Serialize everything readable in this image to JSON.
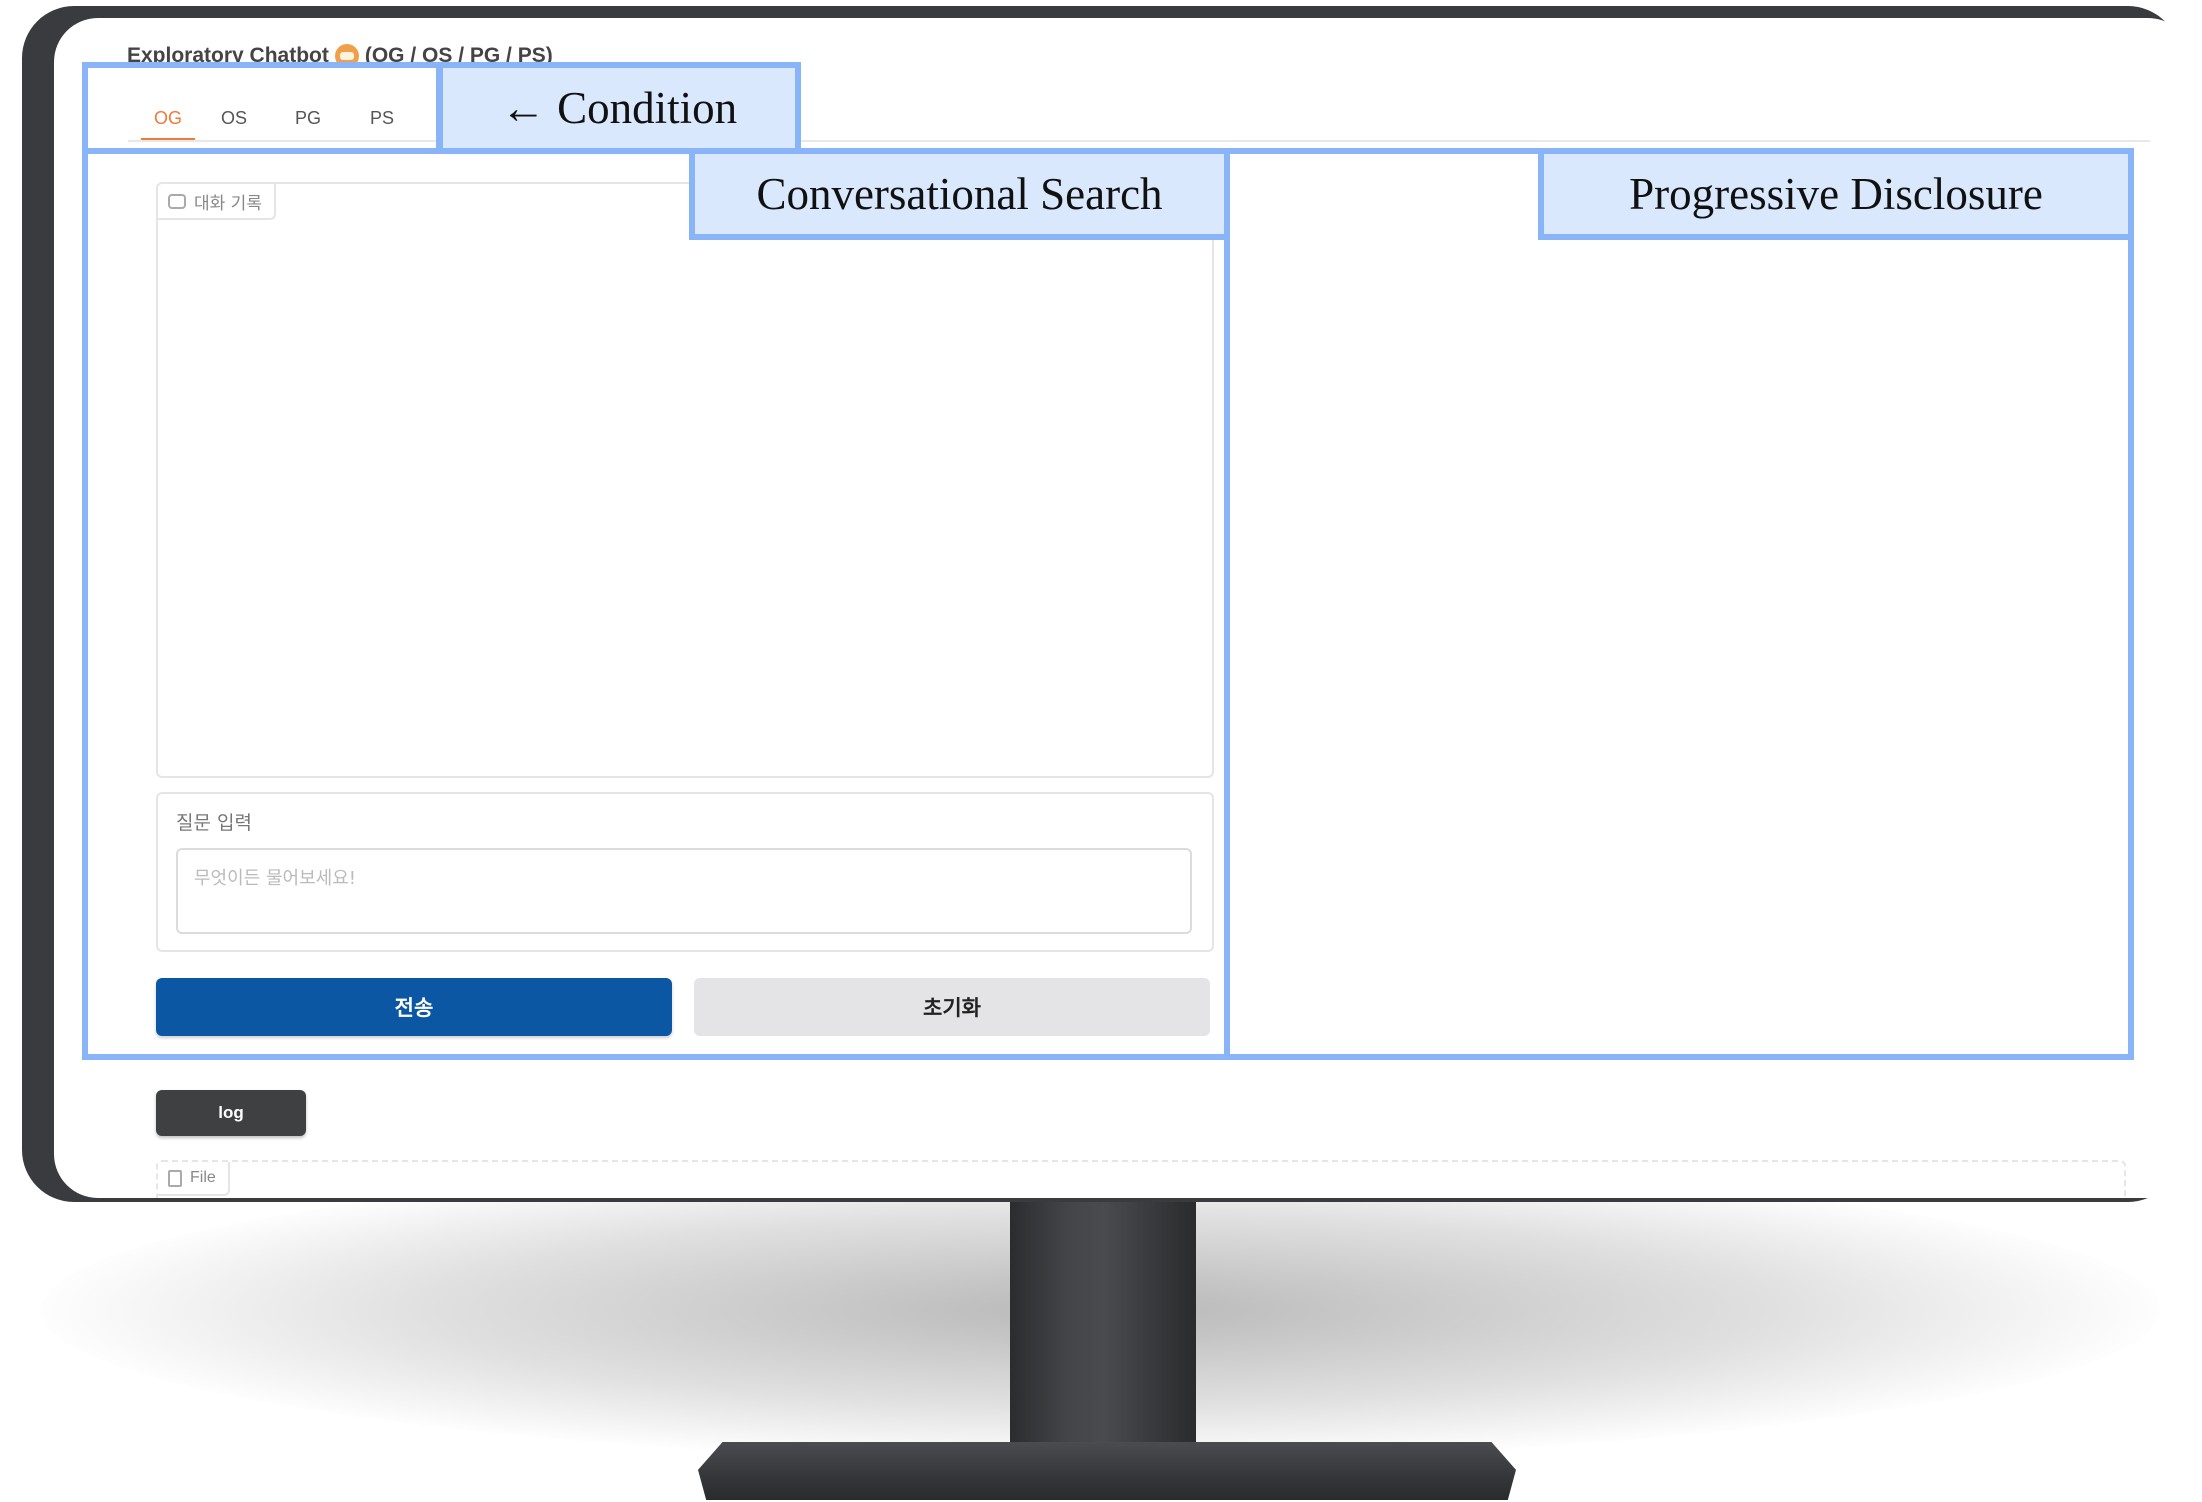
{
  "app": {
    "title_text": "Exploratory Chatbot",
    "title_icon": "robot-icon",
    "title_suffix": "(OG / OS / PG / PS)"
  },
  "tabs": [
    {
      "label": "OG",
      "active": true
    },
    {
      "label": "OS",
      "active": false
    },
    {
      "label": "PG",
      "active": false
    },
    {
      "label": "PS",
      "active": false
    }
  ],
  "chat": {
    "label": "대화 기록",
    "icon": "chat-bubble-icon"
  },
  "question": {
    "label": "질문 입력",
    "placeholder": "무엇이든 물어보세요!",
    "value": ""
  },
  "buttons": {
    "send": "전송",
    "reset": "초기화",
    "log": "log"
  },
  "file": {
    "label": "File",
    "icon": "file-icon"
  },
  "annotations": {
    "condition": "← Condition",
    "conversational_search": "Conversational Search",
    "progressive_disclosure": "Progressive Disclosure"
  },
  "colors": {
    "accent": "#f07a3a",
    "send_button": "#0b57a4",
    "annotation_border": "#8ab4f8",
    "annotation_fill": "#d9e8fc"
  }
}
